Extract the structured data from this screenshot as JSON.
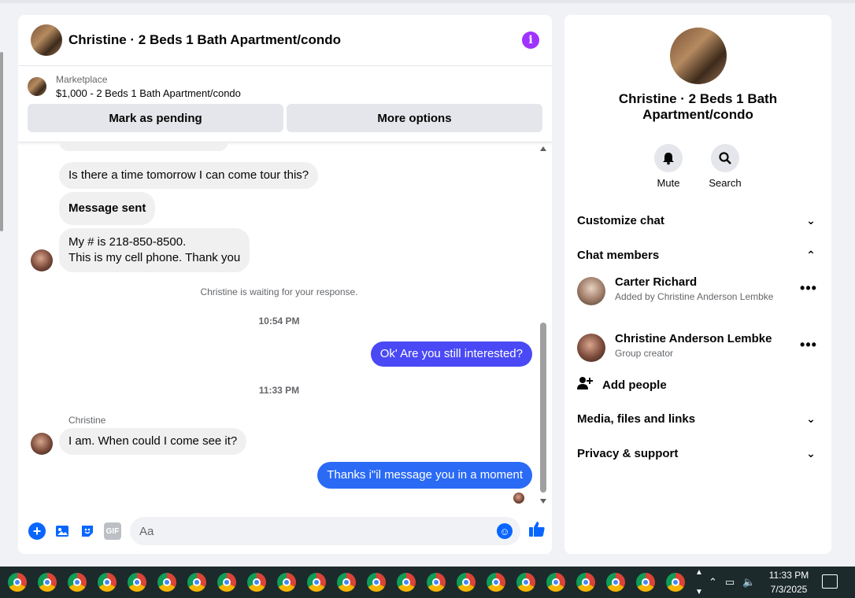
{
  "chat": {
    "title": "Christine · 2 Beds 1 Bath Apartment/condo",
    "marketplace": {
      "label": "Marketplace",
      "listing": "$1,000 - 2 Beds 1 Bath Apartment/condo",
      "buttons": [
        "Mark as pending",
        "More options"
      ]
    },
    "messages": {
      "m1": "Is there a time tomorrow I can come tour this?",
      "m2": "Message sent",
      "m3_line1": "My # is 218-850-8500.",
      "m3_line2": "This is my cell phone.  Thank you",
      "waiting": "Christine is waiting for your response.",
      "time1": "10:54 PM",
      "out1": "Ok' Are you still interested?",
      "time2": "11:33 PM",
      "sender": "Christine",
      "m4": "I am.  When could I come see it?",
      "out2": "Thanks i\"il message you in a moment"
    },
    "composer": {
      "placeholder": "Aa",
      "gif_label": "GIF"
    }
  },
  "info": {
    "title": "Christine · 2 Beds 1 Bath Apartment/condo",
    "actions": [
      "Mute",
      "Search"
    ],
    "sections": {
      "customize": "Customize chat",
      "members": "Chat members",
      "media": "Media, files and links",
      "privacy": "Privacy & support"
    },
    "members": [
      {
        "name": "Carter Richard",
        "sub": "Added by Christine Anderson Lembke"
      },
      {
        "name": "Christine Anderson Lembke",
        "sub": "Group creator"
      }
    ],
    "add_people": "Add people"
  },
  "taskbar": {
    "time": "11:33 PM",
    "date": "7/3/2025"
  },
  "colors": {
    "outgoing_bubble": "#4a49f5",
    "outgoing_bubble_2": "#2a6af5",
    "accent": "#0866ff",
    "info_icon": "#a033ff"
  },
  "icons": [
    "info-icon",
    "plus-icon",
    "photo-icon",
    "sticker-icon",
    "gif-icon",
    "emoji-icon",
    "like-icon",
    "bell-icon",
    "search-icon",
    "chevron-down-icon",
    "chevron-up-icon",
    "more-icon",
    "add-person-icon",
    "chrome-icon"
  ]
}
